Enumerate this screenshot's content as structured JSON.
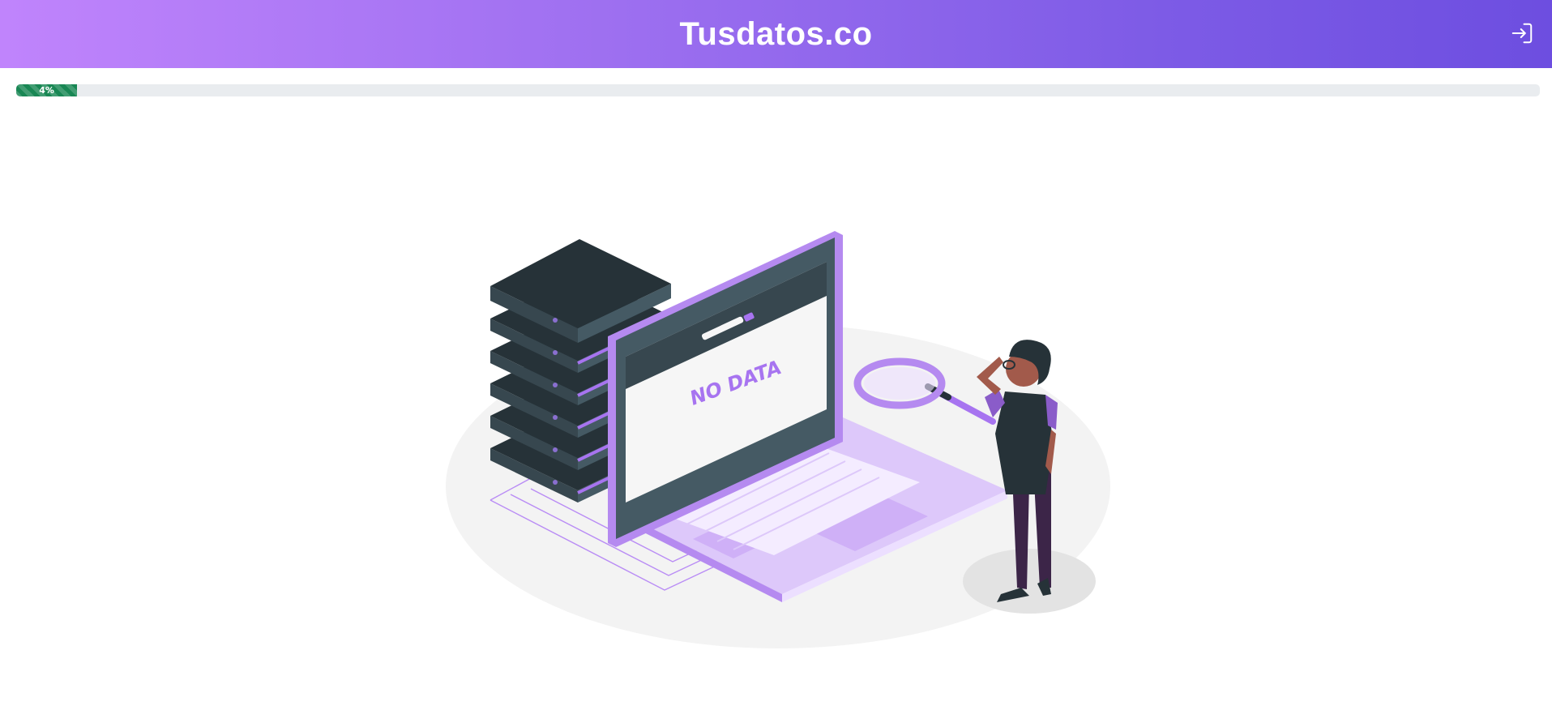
{
  "header": {
    "brand": "Tusdatos.co",
    "login_icon": "sign-in-icon"
  },
  "progress": {
    "value": 4,
    "label": "4%",
    "color": "#198754"
  },
  "empty_state": {
    "illustration_text": "NO DATA",
    "accent_color": "#a774f0"
  },
  "colors": {
    "header_start": "#c084fc",
    "header_end": "#6d4ee0"
  }
}
